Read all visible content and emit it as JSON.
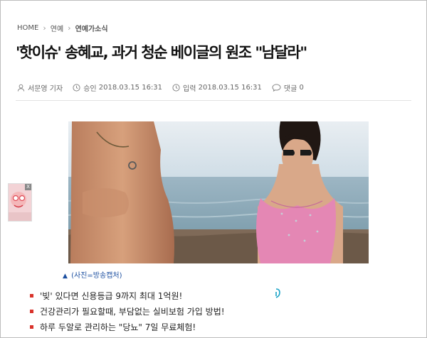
{
  "breadcrumb": {
    "home": "HOME",
    "section": "연예",
    "subsection": "연예가소식"
  },
  "article": {
    "title": "'핫이슈' 송혜교, 과거 청순 베이글의 원조 \"남달라\"",
    "author": "서문영 기자",
    "approved_label": "승인",
    "approved_time": "2018.03.15 16:31",
    "input_label": "입력",
    "input_time": "2018.03.15 16:31",
    "comments_label": "댓글",
    "comments_count": "0"
  },
  "photo": {
    "caption": "(사진=방송캡처)",
    "caption_marker": "▲"
  },
  "side_ad": {
    "close_label": "X"
  },
  "ads": [
    "'빚' 있다면 신용등급 9까지 최대 1억원!",
    "건강관리가 필요할때, 부담없는 실비보험 가입 방법!",
    "하루 두알로 관리하는 \"당뇨\" 7일 무료체험!"
  ],
  "colors": {
    "caption": "#1c4fa0",
    "bullet": "#d9332b",
    "ad_info": "#1aa3c7"
  },
  "icons": {
    "author": "user-icon",
    "approved": "clock-icon",
    "input": "clock-icon",
    "comments": "speech-bubble-icon",
    "ad_info": "info-icon"
  }
}
